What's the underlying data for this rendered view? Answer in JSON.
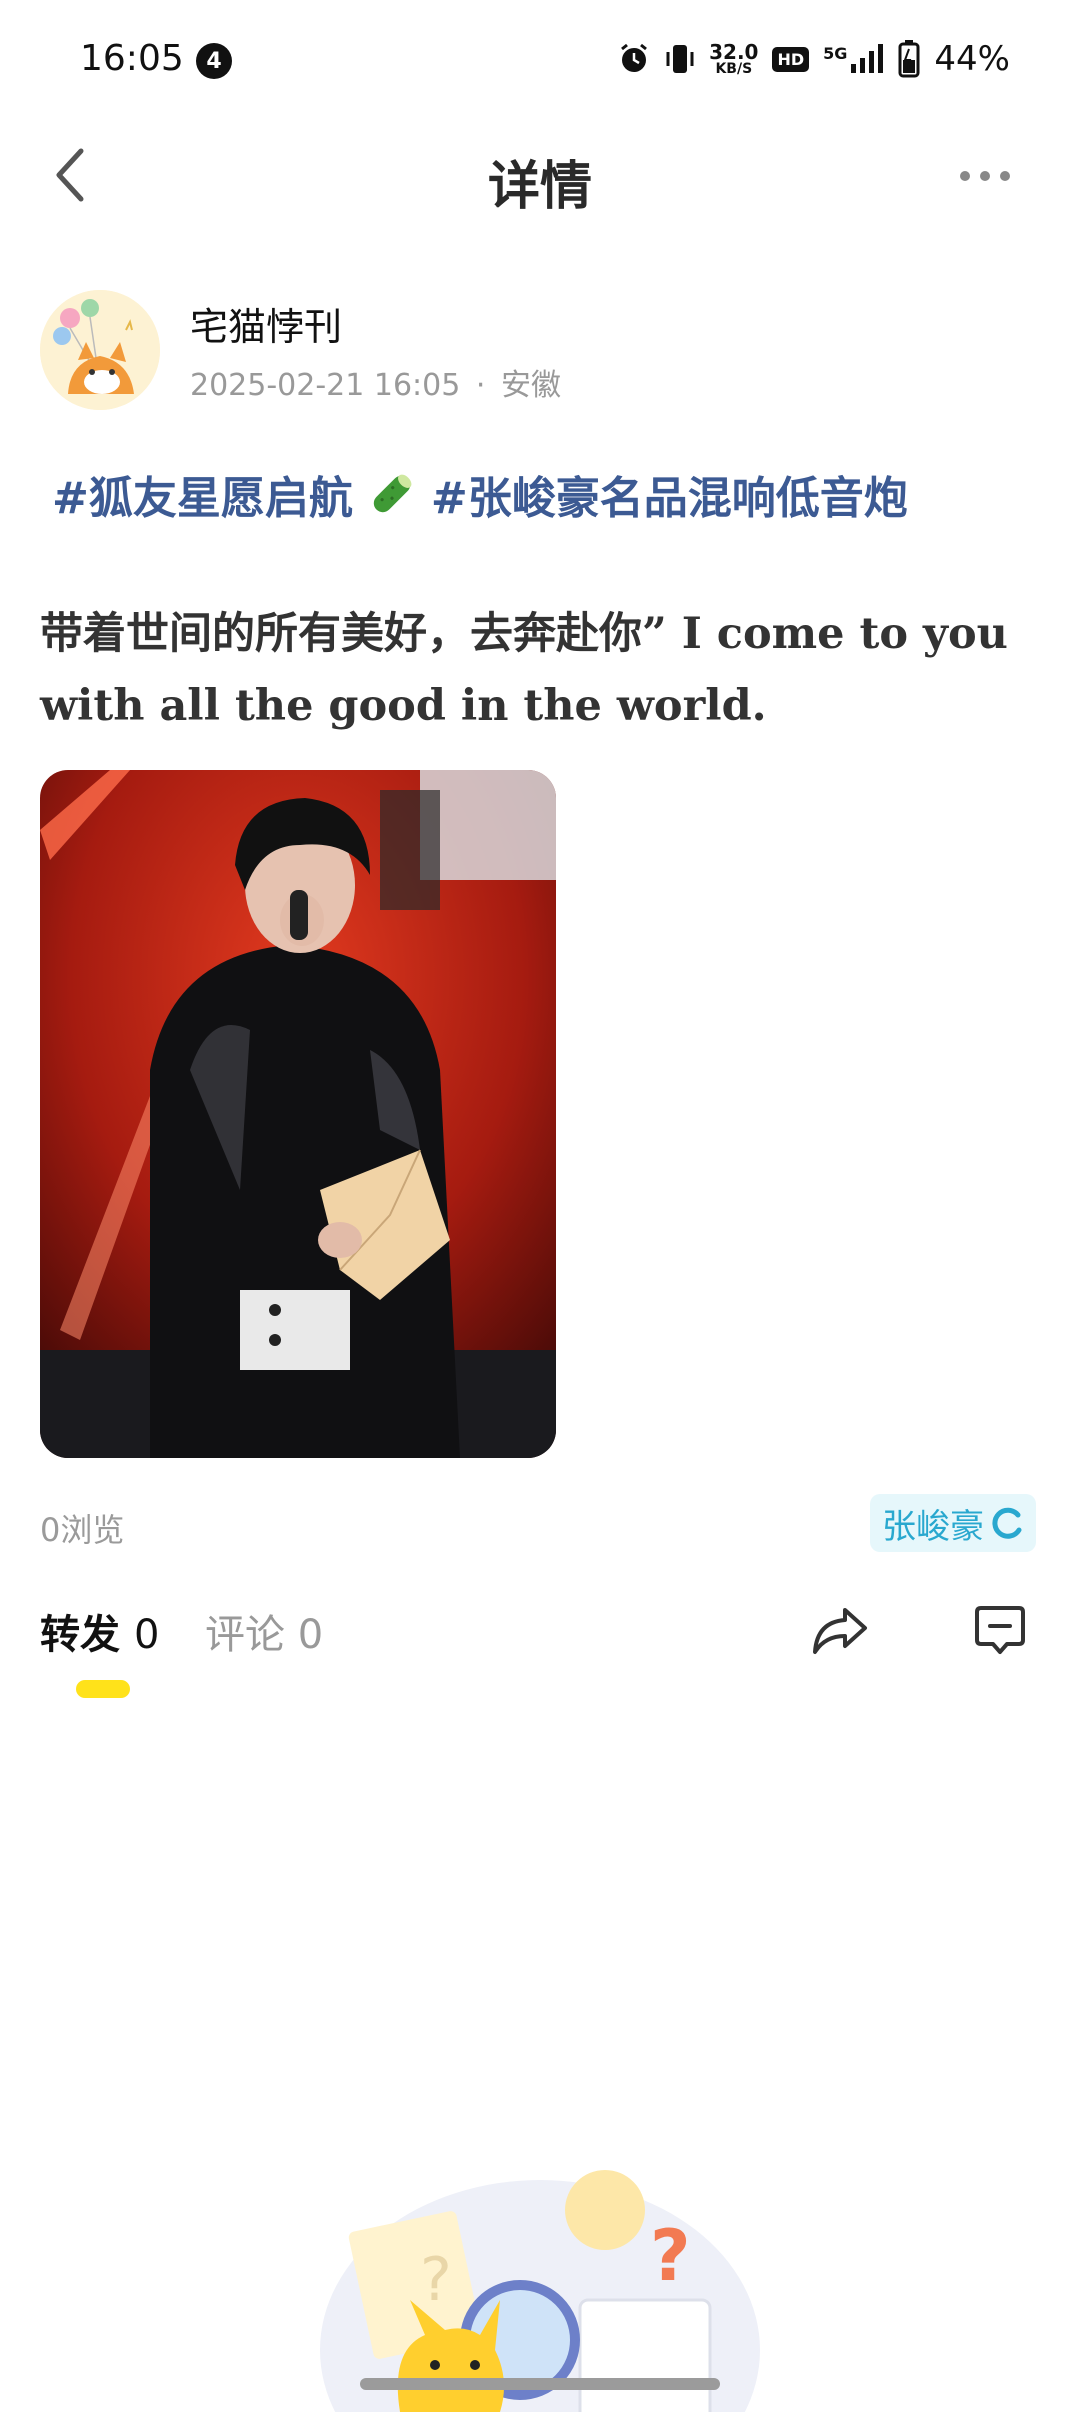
{
  "status_bar": {
    "time": "16:05",
    "notification_count": "4",
    "net_speed_value": "32.0",
    "net_speed_unit": "KB/S",
    "hd_label": "HD",
    "network_label": "5G",
    "battery": "44%"
  },
  "header": {
    "title": "详情"
  },
  "author": {
    "name": "宅猫悖刊",
    "timestamp": "2025-02-21 16:05",
    "separator": "·",
    "location": "安徽"
  },
  "post": {
    "topic_1": "#狐友星愿启航",
    "topic_2": "#张峻豪名品混响低音炮",
    "text": "带着世间的所有美好，去奔赴你” I come to you with all the good in the world.",
    "image_alt": "Performer in black leather jacket singing on stage with red lights"
  },
  "stats": {
    "views": "0浏览",
    "tag": "张峻豪"
  },
  "tabs": {
    "repost_label": "转发",
    "repost_count": "0",
    "comment_label": "评论",
    "comment_count": "0"
  },
  "colors": {
    "topic": "#3c5a93",
    "tab_indicator": "#ffe21a",
    "tag_text": "#29a8cf",
    "tag_bg": "#e6f7fb"
  }
}
